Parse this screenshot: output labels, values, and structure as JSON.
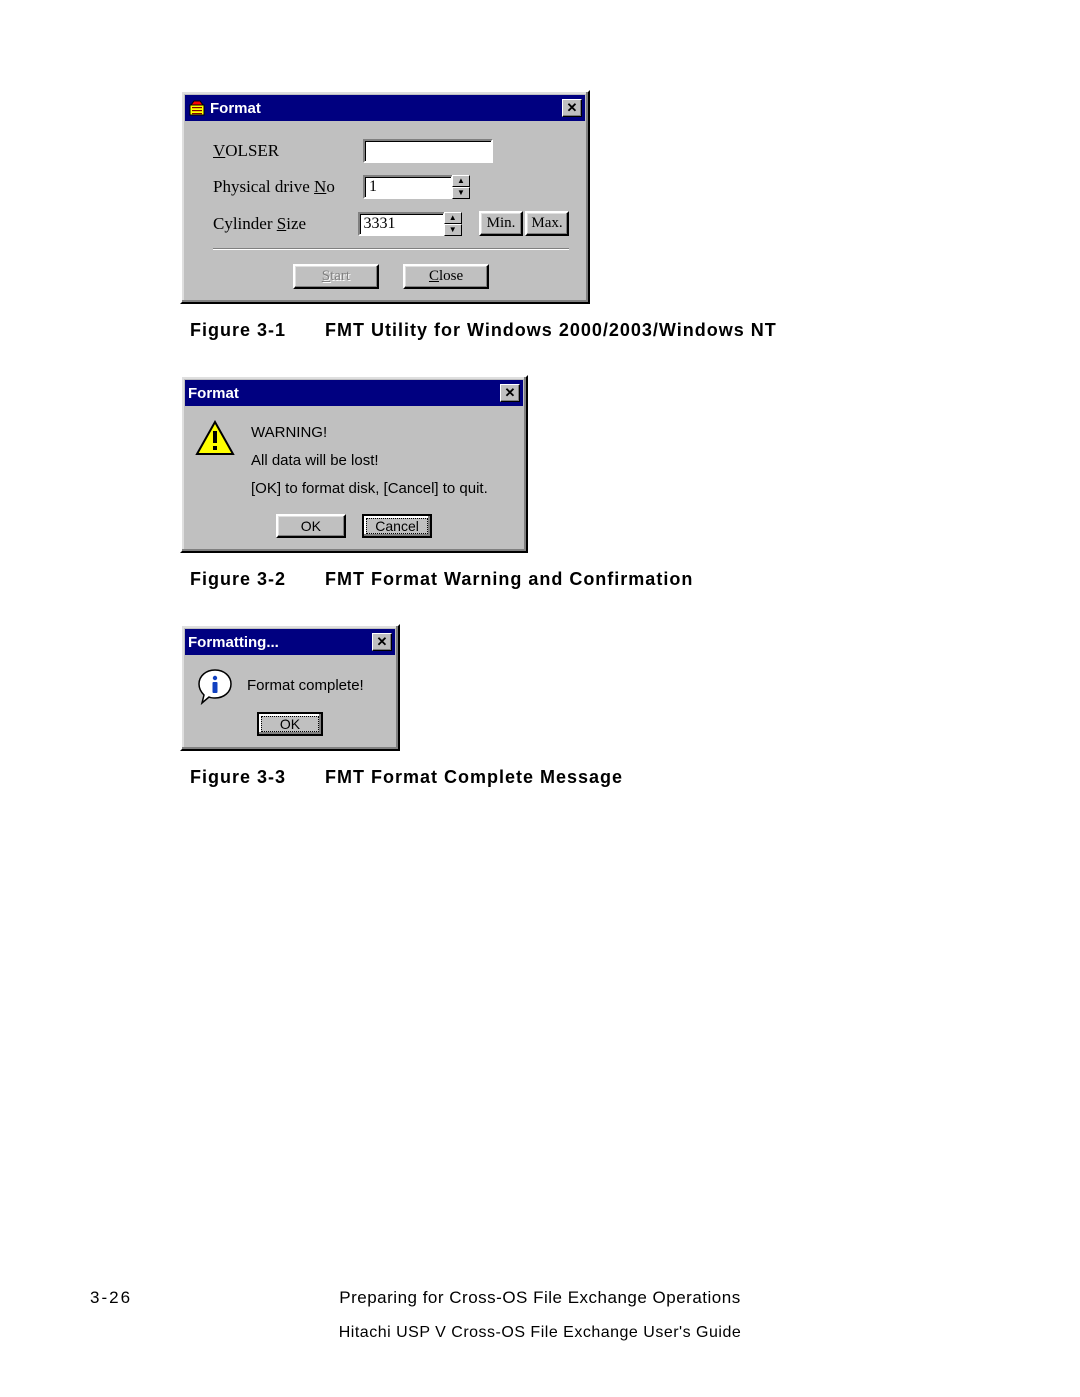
{
  "dialog1": {
    "title": "Format",
    "labels": {
      "volser_pre": "V",
      "volser_post": "OLSER",
      "drive_pre": "Physical drive ",
      "drive_u": "N",
      "drive_post": "o",
      "cyl_pre": "Cylinder ",
      "cyl_u": "S",
      "cyl_post": "ize"
    },
    "values": {
      "volser": "",
      "drive": "1",
      "cyl": "3331"
    },
    "buttons": {
      "min": "Min.",
      "max": "Max.",
      "start_u": "S",
      "start_rest": "tart",
      "close_u": "C",
      "close_rest": "lose"
    }
  },
  "caption1": {
    "num": "Figure 3-1",
    "text": "FMT Utility for Windows 2000/2003/Windows NT"
  },
  "dialog2": {
    "title": "Format",
    "line1": "WARNING!",
    "line2": "All data will be lost!",
    "line3": "[OK] to format disk, [Cancel] to quit.",
    "ok": "OK",
    "cancel": "Cancel"
  },
  "caption2": {
    "num": "Figure 3-2",
    "text": "FMT Format Warning and Confirmation"
  },
  "dialog3": {
    "title": "Formatting...",
    "msg": "Format complete!",
    "ok": "OK"
  },
  "caption3": {
    "num": "Figure 3-3",
    "text": "FMT Format Complete Message"
  },
  "footer": {
    "page": "3-26",
    "chapter": "Preparing for Cross-OS File Exchange Operations",
    "guide": "Hitachi USP V Cross-OS File Exchange User's Guide"
  }
}
